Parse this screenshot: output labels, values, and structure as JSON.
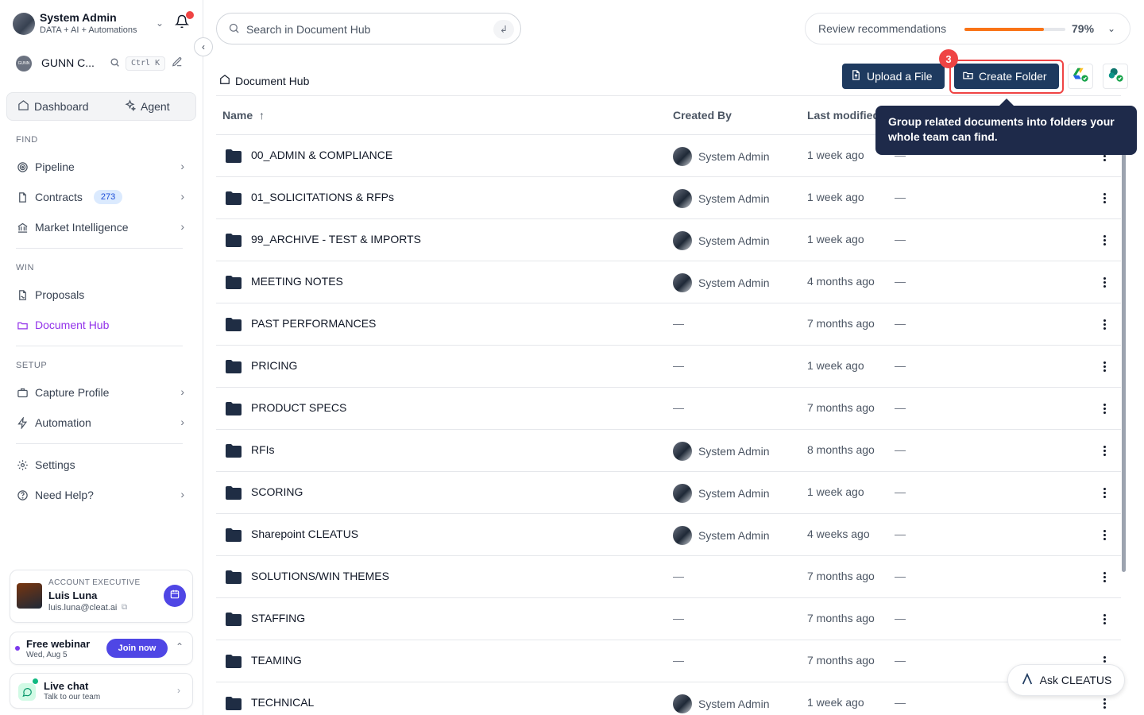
{
  "user": {
    "name": "System Admin",
    "subtitle": "DATA + AI + Automations"
  },
  "org": {
    "logo_text": "GUNN",
    "name": "GUNN C...",
    "shortcut": "Ctrl K"
  },
  "top_tabs": [
    {
      "label": "Dashboard"
    },
    {
      "label": "Agent"
    }
  ],
  "sections": {
    "find": "FIND",
    "win": "WIN",
    "setup": "SETUP"
  },
  "nav": {
    "pipeline": "Pipeline",
    "contracts": "Contracts",
    "contracts_count": "273",
    "market": "Market Intelligence",
    "proposals": "Proposals",
    "document_hub": "Document Hub",
    "capture": "Capture Profile",
    "automation": "Automation",
    "settings": "Settings",
    "help": "Need Help?"
  },
  "account_exec": {
    "label": "ACCOUNT EXECUTIVE",
    "name": "Luis Luna",
    "email": "luis.luna@cleat.ai"
  },
  "webinar": {
    "title": "Free webinar",
    "date": "Wed, Aug 5",
    "join_label": "Join now"
  },
  "live_chat": {
    "title": "Live chat",
    "subtitle": "Talk to our team"
  },
  "search": {
    "placeholder": "Search in Document Hub"
  },
  "review": {
    "label": "Review recommendations",
    "percent_text": "79%",
    "progress": 0.79
  },
  "breadcrumb": "Document Hub",
  "actions": {
    "upload": "Upload a File",
    "create_folder": "Create Folder",
    "step": "3"
  },
  "tooltip": "Group related documents into folders your whole team can find.",
  "table": {
    "headers": {
      "name": "Name",
      "created_by": "Created By",
      "last_modified": "Last modified"
    },
    "rows": [
      {
        "name": "00_ADMIN & COMPLIANCE",
        "created_by": "System Admin",
        "modified": "1 week ago",
        "extra": "—"
      },
      {
        "name": "01_SOLICITATIONS & RFPs",
        "created_by": "System Admin",
        "modified": "1 week ago",
        "extra": "—"
      },
      {
        "name": "99_ARCHIVE - TEST & IMPORTS",
        "created_by": "System Admin",
        "modified": "1 week ago",
        "extra": "—"
      },
      {
        "name": "MEETING NOTES",
        "created_by": "System Admin",
        "modified": "4 months ago",
        "extra": "—"
      },
      {
        "name": "PAST PERFORMANCES",
        "created_by": "—",
        "modified": "7 months ago",
        "extra": "—"
      },
      {
        "name": "PRICING",
        "created_by": "—",
        "modified": "1 week ago",
        "extra": "—"
      },
      {
        "name": "PRODUCT SPECS",
        "created_by": "—",
        "modified": "7 months ago",
        "extra": "—"
      },
      {
        "name": "RFIs",
        "created_by": "System Admin",
        "modified": "8 months ago",
        "extra": "—"
      },
      {
        "name": "SCORING",
        "created_by": "System Admin",
        "modified": "1 week ago",
        "extra": "—"
      },
      {
        "name": "Sharepoint CLEATUS",
        "created_by": "System Admin",
        "modified": "4 weeks ago",
        "extra": "—"
      },
      {
        "name": "SOLUTIONS/WIN THEMES",
        "created_by": "—",
        "modified": "7 months ago",
        "extra": "—"
      },
      {
        "name": "STAFFING",
        "created_by": "—",
        "modified": "7 months ago",
        "extra": "—"
      },
      {
        "name": "TEAMING",
        "created_by": "—",
        "modified": "7 months ago",
        "extra": "—"
      },
      {
        "name": "TECHNICAL",
        "created_by": "System Admin",
        "modified": "1 week ago",
        "extra": "—"
      }
    ]
  },
  "ask_button": "Ask CLEATUS",
  "colors": {
    "primary": "#1e3a5f",
    "accent_purple": "#9333ea",
    "alert_red": "#ef4444",
    "progress_orange": "#f97316",
    "tooltip_bg": "#1e2a4a"
  }
}
